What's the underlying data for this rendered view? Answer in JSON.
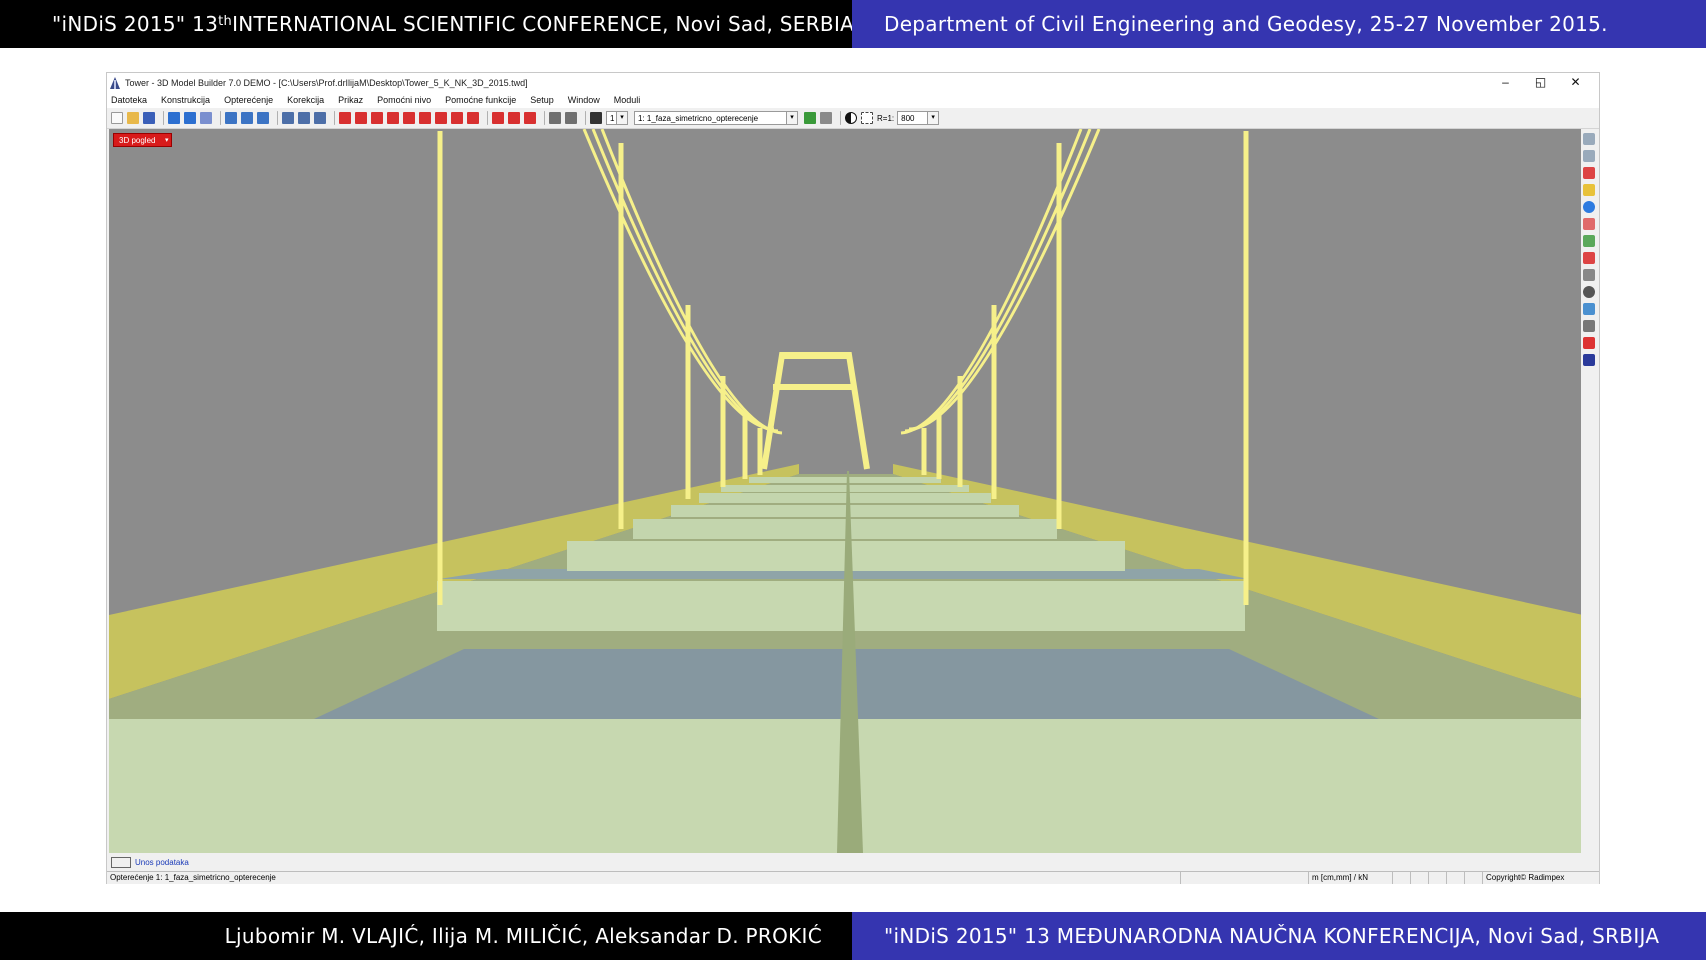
{
  "slide": {
    "header_left_pre": "\"iNDiS 2015\" 13",
    "header_left_sup": "th",
    "header_left_post": " INTERNATIONAL SCIENTIFIC CONFERENCE, Novi Sad, SERBIA",
    "header_right": "Department of Civil Engineering and Geodesy, 25-27 November 2015.",
    "footer_left": "Ljubomir M. VLAJIĆ, Ilija M. MILIČIĆ, Aleksandar D. PROKIĆ",
    "footer_right": "\"iNDiS 2015\" 13 MEĐUNARODNA NAUČNA KONFERENCIJA, Novi Sad, SRBIJA",
    "header_left_bg": "#000000",
    "header_right_bg": "#3535b0"
  },
  "app": {
    "window_title": "Tower - 3D Model Builder 7.0 DEMO - [C:\\Users\\Prof.drIlijaM\\Desktop\\Tower_5_K_NK_3D_2015.twd]",
    "window_controls": {
      "minimize": "–",
      "maximize": "◱",
      "close": "✕"
    },
    "menu": [
      "Datoteka",
      "Konstrukcija",
      "Opterećenje",
      "Korekcija",
      "Prikaz",
      "Pomoćni nivo",
      "Pomoćne funkcije",
      "Setup",
      "Window",
      "Moduli"
    ],
    "toolbar": {
      "layer_value": "1",
      "load_case_value": "1: 1_faza_simetricno_opterecenje",
      "scale_label": "R=1:",
      "scale_value": "800"
    },
    "viewport": {
      "view_badge": "3D pogled",
      "background": "#8c8c8c",
      "deck_color": "#c7d8b0",
      "cable_color": "#f6f08a",
      "water_color": "#8597a0"
    },
    "input_bar_label": "Unos podataka",
    "status": {
      "load_case": "Opterećenje 1: 1_faza_simetricno_opterecenje",
      "units": "m [cm,mm] / kN",
      "copyright": "Copyright© Radimpex"
    }
  }
}
